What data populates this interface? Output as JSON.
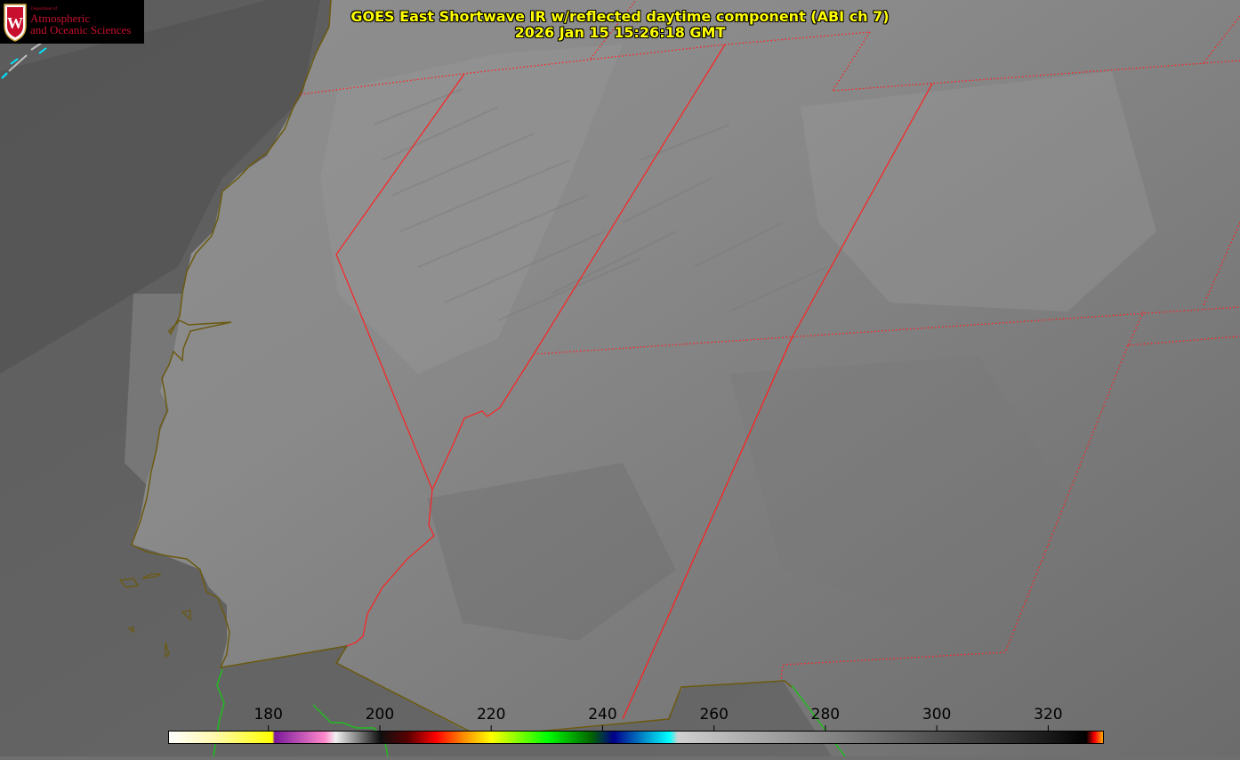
{
  "title": {
    "line1": "GOES East Shortwave IR w/reflected daytime component (ABI ch 7)",
    "line2": "2026 Jan 15 15:26:18 GMT"
  },
  "logo": {
    "department": "Department of",
    "line1": "Atmospheric",
    "line2": "and Oceanic Sciences",
    "crest_letter": "W"
  },
  "colorbar": {
    "min": 162,
    "max": 330,
    "ticks": [
      180,
      200,
      220,
      240,
      260,
      280,
      300,
      320
    ],
    "tick_labels": [
      "180",
      "200",
      "220",
      "240",
      "260",
      "280",
      "300",
      "320"
    ],
    "stops": [
      {
        "v": 162,
        "color": "#ffffff"
      },
      {
        "v": 170,
        "color": "#fff9b0"
      },
      {
        "v": 180.6,
        "color": "#ffff00"
      },
      {
        "v": 181,
        "color": "#7a1a9a"
      },
      {
        "v": 190,
        "color": "#ff88cc"
      },
      {
        "v": 192,
        "color": "#f0f0f0"
      },
      {
        "v": 200,
        "color": "#101010"
      },
      {
        "v": 205,
        "color": "#5a0000"
      },
      {
        "v": 210,
        "color": "#ff0000"
      },
      {
        "v": 215,
        "color": "#ff8c00"
      },
      {
        "v": 220,
        "color": "#ffff00"
      },
      {
        "v": 230,
        "color": "#00ff00"
      },
      {
        "v": 238,
        "color": "#006400"
      },
      {
        "v": 242,
        "color": "#00008b"
      },
      {
        "v": 252,
        "color": "#00ffff"
      },
      {
        "v": 253.5,
        "color": "#d0d0d0"
      },
      {
        "v": 300,
        "color": "#505050"
      },
      {
        "v": 320,
        "color": "#1a1a1a"
      },
      {
        "v": 327,
        "color": "#000000"
      },
      {
        "v": 328.5,
        "color": "#ff0000"
      },
      {
        "v": 330,
        "color": "#ffaa00"
      }
    ]
  },
  "colors": {
    "state_borders": "#ff2020",
    "coastline": "#6b5a10",
    "coast_green": "#22bb22",
    "cloud_cyan": "#00e5ff"
  }
}
